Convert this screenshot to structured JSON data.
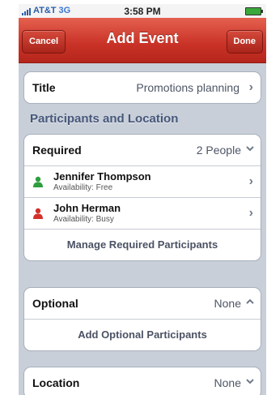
{
  "status_bar": {
    "carrier": "AT&T",
    "network": "3G",
    "time": "3:58 PM"
  },
  "nav": {
    "cancel": "Cancel",
    "title": "Add Event",
    "done": "Done"
  },
  "title_row": {
    "label": "Title",
    "value": "Promotions planning"
  },
  "section_header": "Participants and Location",
  "required": {
    "label": "Required",
    "value": "2 People",
    "people": [
      {
        "name": "Jennifer Thompson",
        "availability": "Availability: Free",
        "color": "#2e9e3e"
      },
      {
        "name": "John Herman",
        "availability": "Availability: Busy",
        "color": "#d2312a"
      }
    ],
    "manage": "Manage Required Participants"
  },
  "optional": {
    "label": "Optional",
    "value": "None",
    "add": "Add Optional Participants"
  },
  "location": {
    "label": "Location",
    "value": "None"
  },
  "colors": {
    "nav_red": "#c93226",
    "background": "#c8cfd9",
    "section_text": "#46577a"
  }
}
